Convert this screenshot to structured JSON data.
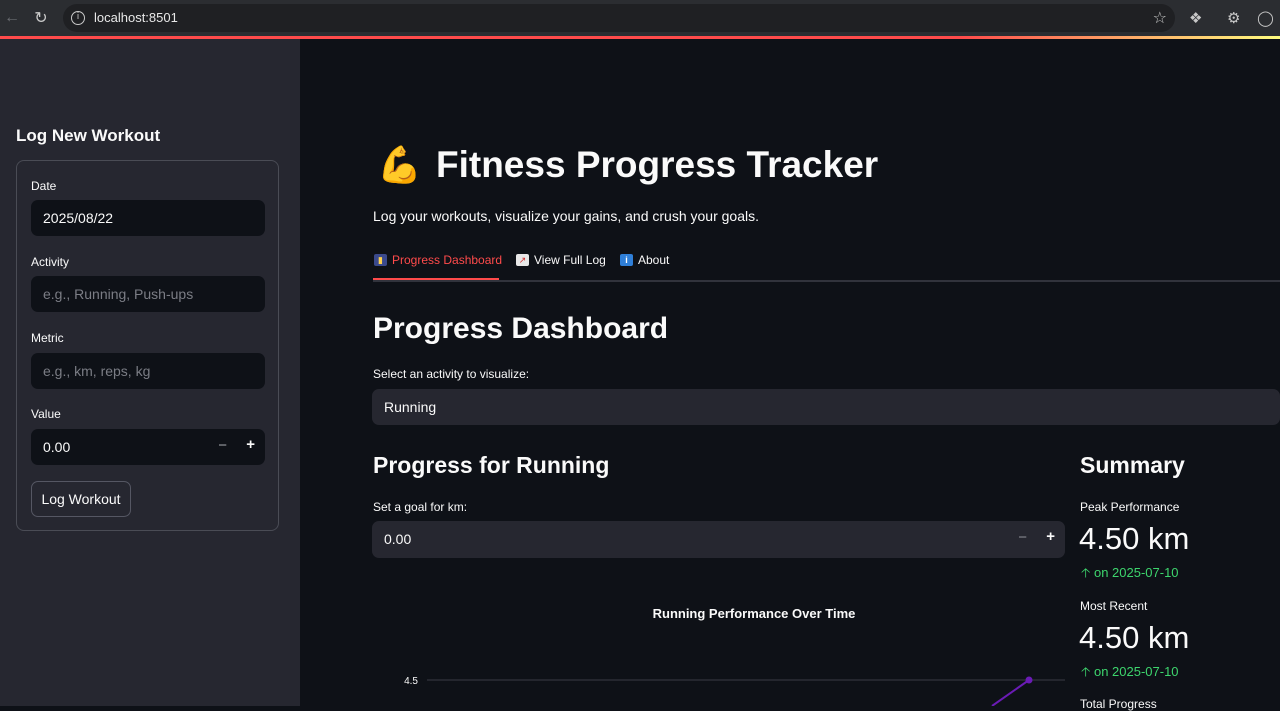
{
  "browser": {
    "url": "localhost:8501"
  },
  "sidebar": {
    "title": "Log New Workout",
    "date_label": "Date",
    "date_value": "2025/08/22",
    "activity_label": "Activity",
    "activity_placeholder": "e.g., Running, Push-ups",
    "metric_label": "Metric",
    "metric_placeholder": "e.g., km, reps, kg",
    "value_label": "Value",
    "value_value": "0.00",
    "stepper_minus": "−",
    "stepper_plus": "+",
    "submit_label": "Log Workout"
  },
  "header": {
    "icon": "💪",
    "title": "Fitness Progress Tracker",
    "subtitle": "Log your workouts, visualize your gains, and crush your goals."
  },
  "tabs": [
    {
      "icon": "bar-chart-icon",
      "label": "Progress Dashboard",
      "active": true
    },
    {
      "icon": "trend-chart-icon",
      "label": "View Full Log",
      "active": false
    },
    {
      "icon": "info-icon",
      "label": "About",
      "active": false
    }
  ],
  "dashboard": {
    "title": "Progress Dashboard",
    "select_label": "Select an activity to visualize:",
    "selected_activity": "Running",
    "progress_title": "Progress for Running",
    "goal_label": "Set a goal for km:",
    "goal_value": "0.00",
    "goal_minus": "−",
    "goal_plus": "+"
  },
  "summary": {
    "title": "Summary",
    "peak_label": "Peak Performance",
    "peak_value": "4.50 km",
    "peak_delta": "on 2025-07-10",
    "recent_label": "Most Recent",
    "recent_value": "4.50 km",
    "recent_delta": "on 2025-07-10",
    "total_label": "Total Progress"
  },
  "chart_data": {
    "type": "line",
    "title": "Running Performance Over Time",
    "y_ticks": [
      "4.5"
    ],
    "series": [
      {
        "values": [
          4.5
        ]
      }
    ],
    "series_color": "#6a1bb5"
  },
  "colors": {
    "accent": "#ff4b4b",
    "positive": "#3dd56d",
    "background": "#0e1117",
    "sidebar": "#262730"
  }
}
